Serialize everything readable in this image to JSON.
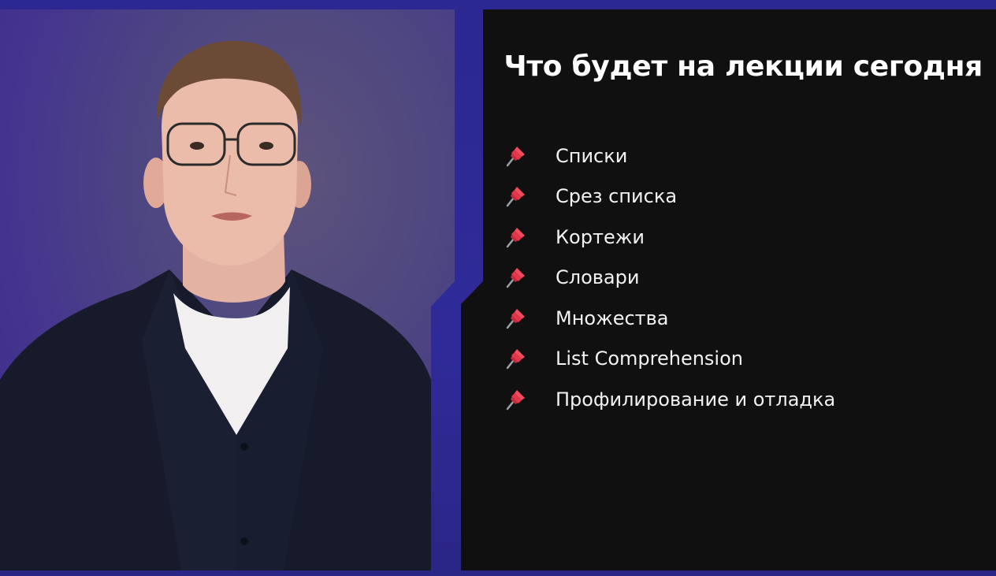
{
  "colors": {
    "background": "#2d2a8f",
    "slide_background": "#101010",
    "accent_pin": "#e3364a"
  },
  "speaker_video": {
    "icon": "speaker-photo"
  },
  "slide": {
    "title": "Что будет на лекции сегодня",
    "bullet_icon": "pushpin-icon",
    "items": [
      {
        "label": "Списки"
      },
      {
        "label": "Срез списка"
      },
      {
        "label": "Кортежи"
      },
      {
        "label": "Словари"
      },
      {
        "label": "Множества"
      },
      {
        "label": "List Comprehension"
      },
      {
        "label": "Профилирование и отладка"
      }
    ]
  }
}
